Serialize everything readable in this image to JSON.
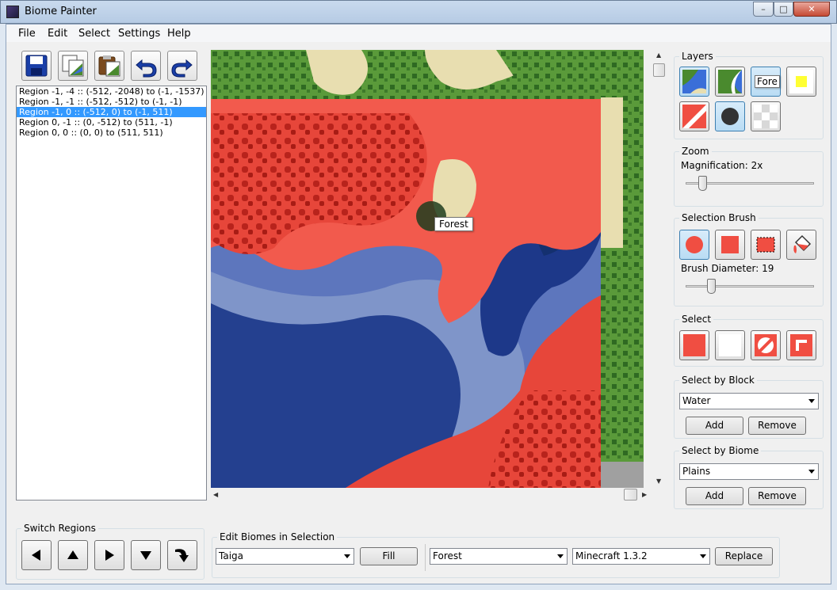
{
  "window": {
    "title": "Biome Painter",
    "minimize": "–",
    "maximize": "□",
    "close": "✕"
  },
  "menu": [
    {
      "label": "File"
    },
    {
      "label": "Edit"
    },
    {
      "label": "Select"
    },
    {
      "label": "Settings"
    },
    {
      "label": "Help"
    }
  ],
  "toolbar": {
    "icons": [
      "save-icon",
      "copy-icon",
      "paste-icon",
      "undo-icon",
      "redo-icon"
    ]
  },
  "regions": [
    "Region -1, -4 :: (-512, -2048) to (-1, -1537)",
    "Region -1, -1 :: (-512, -512) to (-1, -1)",
    "Region -1, 0 :: (-512, 0) to (-1, 511)",
    "Region 0, -1 :: (0, -512) to (511, -1)",
    "Region 0, 0 :: (0, 0) to (511, 511)"
  ],
  "selected_region_index": 2,
  "map": {
    "tooltip": "Forest"
  },
  "layers": {
    "title": "Layers",
    "tooltip": "Fore"
  },
  "zoom": {
    "title": "Zoom",
    "magnification": "Magnification: 2x"
  },
  "selection_brush": {
    "title": "Selection Brush",
    "diameter": "Brush Diameter: 19"
  },
  "select": {
    "title": "Select"
  },
  "select_by_block": {
    "title": "Select by Block",
    "value": "Water",
    "add": "Add",
    "remove": "Remove"
  },
  "select_by_biome": {
    "title": "Select by Biome",
    "value": "Plains",
    "add": "Add",
    "remove": "Remove"
  },
  "switch_regions": {
    "title": "Switch Regions"
  },
  "edit_biomes": {
    "title": "Edit Biomes in Selection",
    "biome": "Taiga",
    "fill": "Fill",
    "replace_biome": "Forest",
    "version": "Minecraft 1.3.2",
    "replace": "Replace"
  },
  "colors": {
    "selection": "#f04e42",
    "water": "#223c94",
    "grass": "#4a8a2e",
    "sand": "#e8deb0",
    "highlight": "#3399ff"
  }
}
